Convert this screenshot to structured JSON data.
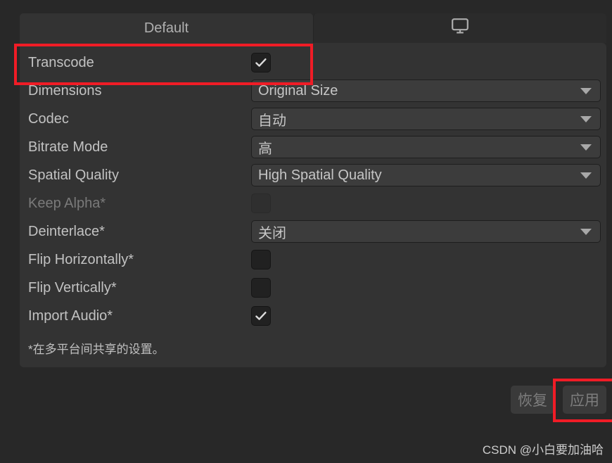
{
  "window": {
    "background_color": "#282828",
    "panel_color": "#333333"
  },
  "tabs": [
    {
      "id": "default",
      "label": "Default",
      "active": true,
      "icon": null
    },
    {
      "id": "platform",
      "label": "",
      "active": false,
      "icon": "monitor-icon"
    }
  ],
  "settings_rows": [
    {
      "id": "transcode",
      "label": "Transcode",
      "type": "checkbox",
      "checked": true,
      "disabled": false
    },
    {
      "id": "dimensions",
      "label": "Dimensions",
      "type": "dropdown",
      "value": "Original Size",
      "disabled": false
    },
    {
      "id": "codec",
      "label": "Codec",
      "type": "dropdown",
      "value": "自动",
      "disabled": false
    },
    {
      "id": "bitrate-mode",
      "label": "Bitrate Mode",
      "type": "dropdown",
      "value": "高",
      "disabled": false
    },
    {
      "id": "spatial-quality",
      "label": "Spatial Quality",
      "type": "dropdown",
      "value": "High Spatial Quality",
      "disabled": false
    },
    {
      "id": "keep-alpha",
      "label": "Keep Alpha*",
      "type": "checkbox",
      "checked": false,
      "disabled": true
    },
    {
      "id": "deinterlace",
      "label": "Deinterlace*",
      "type": "dropdown",
      "value": "关闭",
      "disabled": false
    },
    {
      "id": "flip-horizontally",
      "label": "Flip Horizontally*",
      "type": "checkbox",
      "checked": false,
      "disabled": false
    },
    {
      "id": "flip-vertically",
      "label": "Flip Vertically*",
      "type": "checkbox",
      "checked": false,
      "disabled": false
    },
    {
      "id": "import-audio",
      "label": "Import Audio*",
      "type": "checkbox",
      "checked": true,
      "disabled": false
    }
  ],
  "footnote": "*在多平台间共享的设置。",
  "footer": {
    "revert_label": "恢复",
    "apply_label": "应用",
    "revert_disabled": true,
    "apply_disabled": true
  },
  "annotations": {
    "color": "#f01c26",
    "items": [
      {
        "id": "transcode-highlight",
        "target": "transcode-row"
      },
      {
        "id": "apply-highlight",
        "target": "apply-button"
      }
    ]
  },
  "watermark": "CSDN @小白要加油哈"
}
